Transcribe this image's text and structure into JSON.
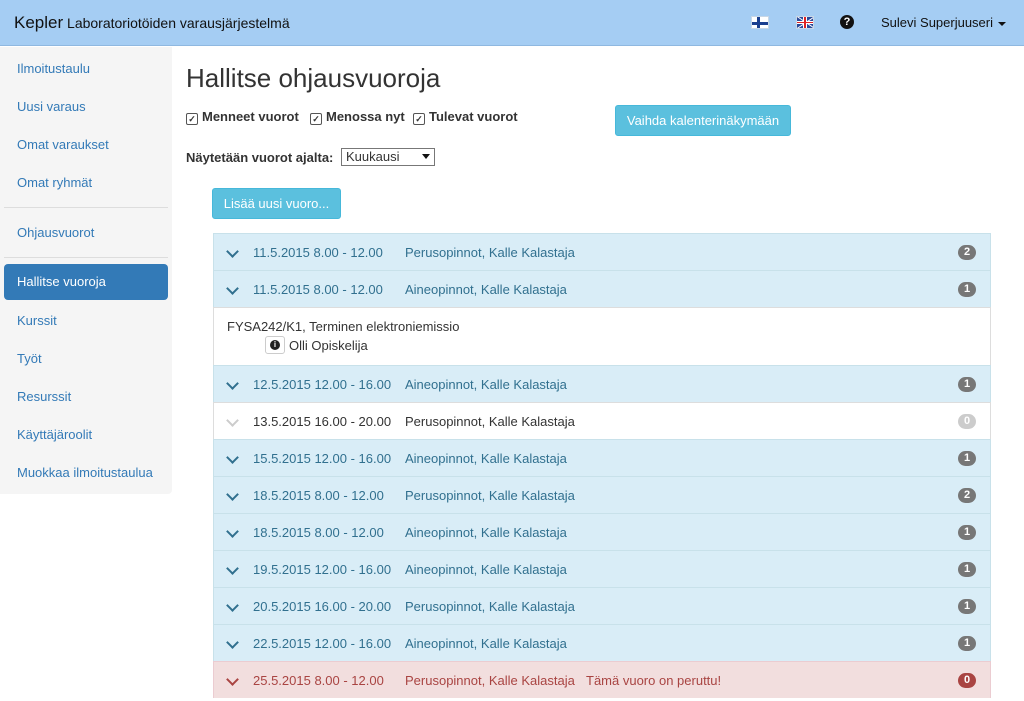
{
  "navbar": {
    "brand_name": "Kepler",
    "brand_subtitle": "Laboratoriotöiden varausjärjestelmä",
    "help_icon_text": "?",
    "user_name": "Sulevi Superjuuseri"
  },
  "sidebar": {
    "items": [
      {
        "label": "Ilmoitustaulu"
      },
      {
        "label": "Uusi varaus"
      },
      {
        "label": "Omat varaukset"
      },
      {
        "label": "Omat ryhmät"
      },
      {
        "label": "Ohjausvuorot"
      },
      {
        "label": "Hallitse vuoroja"
      },
      {
        "label": "Kurssit"
      },
      {
        "label": "Työt"
      },
      {
        "label": "Resurssit"
      },
      {
        "label": "Käyttäjäroolit"
      },
      {
        "label": "Muokkaa ilmoitustaulua"
      }
    ]
  },
  "main": {
    "title": "Hallitse ohjausvuoroja",
    "filters": {
      "past": "Menneet vuorot",
      "current": "Menossa nyt",
      "upcoming": "Tulevat vuorot"
    },
    "calendar_button": "Vaihda kalenterinäkymään",
    "period_label": "Näytetään vuorot ajalta:",
    "period_value": "Kuukausi",
    "add_button": "Lisää uusi vuoro...",
    "shifts": [
      {
        "date": "11.5.2015 8.00 - 12.00",
        "course": "Perusopinnot, Kalle Kalastaja",
        "count": "2"
      },
      {
        "date": "11.5.2015 8.00 - 12.00",
        "course": "Aineopinnot, Kalle Kalastaja",
        "count": "1"
      },
      {
        "date": "12.5.2015 12.00 - 16.00",
        "course": "Aineopinnot, Kalle Kalastaja",
        "count": "1"
      },
      {
        "date": "13.5.2015 16.00 - 20.00",
        "course": "Perusopinnot, Kalle Kalastaja",
        "count": "0"
      },
      {
        "date": "15.5.2015 12.00 - 16.00",
        "course": "Aineopinnot, Kalle Kalastaja",
        "count": "1"
      },
      {
        "date": "18.5.2015 8.00 - 12.00",
        "course": "Perusopinnot, Kalle Kalastaja",
        "count": "2"
      },
      {
        "date": "18.5.2015 8.00 - 12.00",
        "course": "Aineopinnot, Kalle Kalastaja",
        "count": "1"
      },
      {
        "date": "19.5.2015 12.00 - 16.00",
        "course": "Aineopinnot, Kalle Kalastaja",
        "count": "1"
      },
      {
        "date": "20.5.2015 16.00 - 20.00",
        "course": "Perusopinnot, Kalle Kalastaja",
        "count": "1"
      },
      {
        "date": "22.5.2015 12.00 - 16.00",
        "course": "Aineopinnot, Kalle Kalastaja",
        "count": "1"
      },
      {
        "date": "25.5.2015 8.00 - 12.00",
        "course": "Perusopinnot, Kalle Kalastaja",
        "note": "Tämä vuoro on peruttu!",
        "count": "0"
      }
    ],
    "expanded_detail": {
      "work": "FYSA242/K1, Terminen elektroniemissio",
      "info_icon_text": "i",
      "student": "Olli Opiskelija"
    }
  }
}
